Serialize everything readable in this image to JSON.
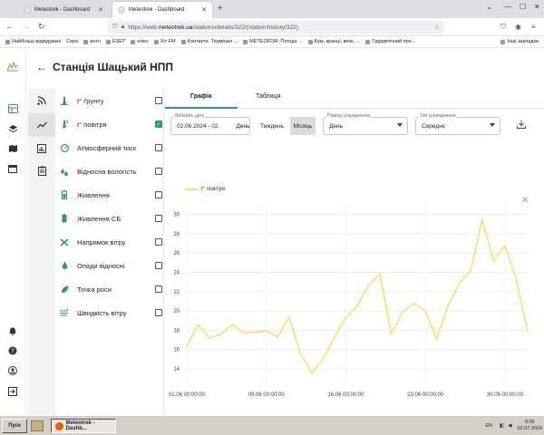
{
  "browser": {
    "tabs": [
      {
        "title": "Meteotrek - Dashboard"
      },
      {
        "title": "Meteotrek - Dashboard"
      }
    ],
    "url_prefix": "https://web.",
    "url_domain": "meteotrek.ua",
    "url_path": "/stations/details/322/(station:history/322)",
    "bookmarks": [
      "Найбільш відвідувані",
      "Сере",
      "антн",
      "ESET",
      "кліко",
      "Хіт FM",
      "Контакти. Термінал ...",
      "METEOFOR: Погода ...",
      "Бум, кранці, вехк, ...",
      "Гідравлічний пре..."
    ],
    "bookmarks_right": "Інші закладки"
  },
  "station": {
    "title": "Станція Шацький НПП"
  },
  "sensors": [
    {
      "label": "t° ґрунту",
      "icon": "thermometer-soil-icon",
      "checked": false
    },
    {
      "label": "t° повітря",
      "icon": "thermometer-air-icon",
      "checked": true
    },
    {
      "label": "Атмосферний тиск",
      "icon": "pressure-gauge-icon",
      "checked": false
    },
    {
      "label": "Відносна вологість",
      "icon": "humidity-drops-icon",
      "checked": false
    },
    {
      "label": "Живлення",
      "icon": "battery-icon",
      "checked": false
    },
    {
      "label": "Живлення СБ",
      "icon": "solar-battery-icon",
      "checked": false
    },
    {
      "label": "Напрямок вітру",
      "icon": "wind-direction-icon",
      "checked": false
    },
    {
      "label": "Опади відносні",
      "icon": "precipitation-icon",
      "checked": false
    },
    {
      "label": "Точка роси",
      "icon": "dew-point-leaf-icon",
      "checked": false
    },
    {
      "label": "Швидкість вітру",
      "icon": "wind-speed-icon",
      "checked": false
    }
  ],
  "view_tabs": [
    {
      "label": "Графік",
      "active": true
    },
    {
      "label": "Таблиця",
      "active": false
    }
  ],
  "controls": {
    "date_label": "Виберіть дату",
    "date_value": "02.06.2024 - 02.",
    "periods": [
      "День",
      "Тиждень",
      "Місяць"
    ],
    "active_period": "Місяць",
    "averaging_label": "Період усереднення",
    "averaging_value": "День",
    "avg_type_label": "Тип усереднення",
    "avg_type_value": "Середнє"
  },
  "colors": {
    "accent": "#2e9a6e",
    "series": "#f3e56a"
  },
  "chart_data": {
    "type": "line",
    "series": [
      {
        "name": "t° повітря",
        "x": [
          "02.06",
          "03.06",
          "04.06",
          "05.06",
          "06.06",
          "07.06",
          "08.06",
          "09.06",
          "10.06",
          "11.06",
          "12.06",
          "13.06",
          "14.06",
          "15.06",
          "16.06",
          "17.06",
          "18.06",
          "19.06",
          "20.06",
          "21.06",
          "22.06",
          "23.06",
          "24.06",
          "25.06",
          "26.06",
          "27.06",
          "28.06",
          "29.06",
          "30.06",
          "01.07",
          "02.07"
        ],
        "values": [
          16.3,
          18.6,
          17.2,
          17.6,
          18.6,
          17.7,
          17.8,
          17.9,
          17.3,
          19.4,
          15.6,
          13.6,
          15.0,
          17.3,
          19.3,
          20.5,
          22.7,
          23.8,
          17.6,
          19.9,
          20.8,
          20.0,
          17.1,
          20.6,
          22.9,
          24.2,
          29.5,
          25.2,
          26.8,
          23.2,
          17.9
        ]
      }
    ],
    "x_ticks": [
      "02.06 00:00:00",
      "09.06 00:00:00",
      "16.06 00:00:00",
      "23.06 00:00:00",
      "30.06 00:00:00"
    ],
    "y_ticks": [
      14,
      16,
      18,
      20,
      22,
      24,
      26,
      28,
      30
    ],
    "ylim": [
      12.5,
      31
    ],
    "grid": true,
    "legend": "top-left"
  },
  "taskbar": {
    "start": "Пуск",
    "task": "Meteotrek - Dashb...",
    "lang": "EN",
    "time": "9:05",
    "date": "02.07.2024"
  }
}
